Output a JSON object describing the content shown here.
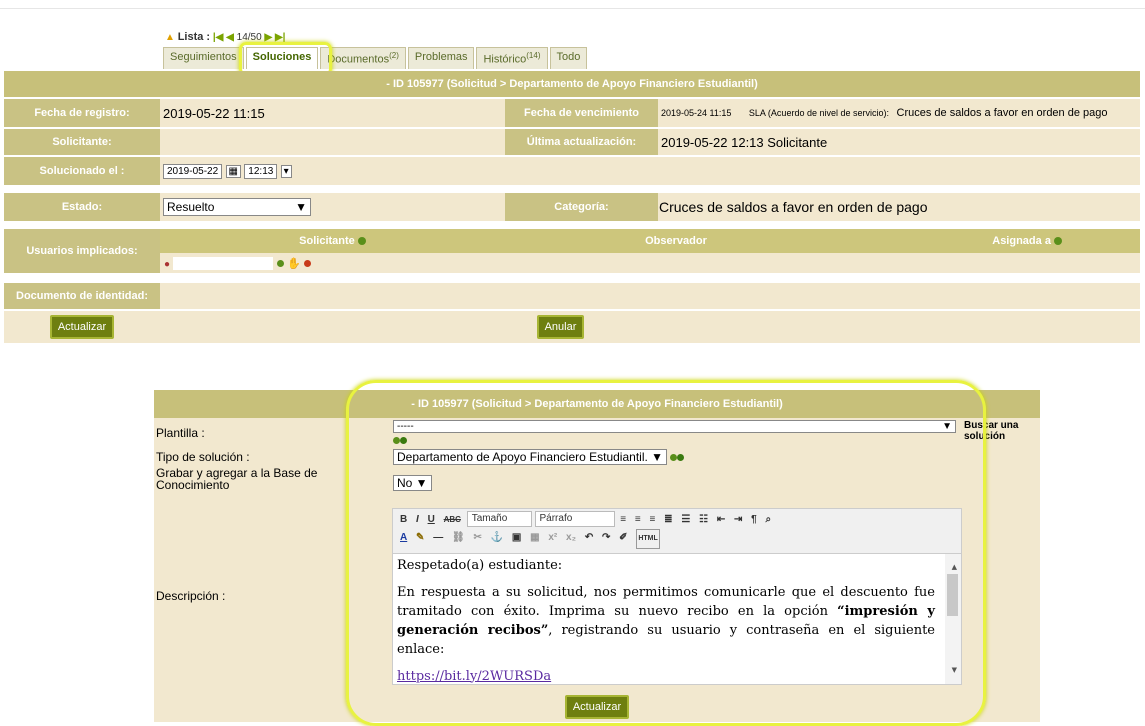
{
  "nav": {
    "lista_label": "Lista :",
    "counter": "14/50"
  },
  "tabs": [
    {
      "label": "Seguimientos",
      "count": ""
    },
    {
      "label": "Soluciones",
      "count": ""
    },
    {
      "label": "Documentos",
      "count": "(2)"
    },
    {
      "label": "Problemas",
      "count": ""
    },
    {
      "label": "Histórico",
      "count": "(14)"
    },
    {
      "label": "Todo",
      "count": ""
    }
  ],
  "ticket": {
    "title": "- ID 105977 (Solicitud > Departamento de Apoyo Financiero Estudiantil)",
    "fecha_registro_label": "Fecha de registro:",
    "fecha_registro": "2019-05-22 11:15",
    "fecha_venc_label": "Fecha de vencimiento",
    "fecha_venc": "2019-05-24 11:15",
    "sla_label": "SLA (Acuerdo de nivel de servicio):",
    "sla_value": "Cruces de saldos a favor en orden de pago",
    "solicitante_label": "Solicitante:",
    "ultima_label": "Última actualización:",
    "ultima_value": "2019-05-22 12:13 Solicitante",
    "solucionado_label": "Solucionado el :",
    "solucionado_date": "2019-05-22",
    "solucionado_time": "12:13",
    "estado_label": "Estado:",
    "estado_value": "Resuelto",
    "categoria_label": "Categoría:",
    "categoria_value": "Cruces de saldos a favor en orden de pago",
    "usuarios_label": "Usuarios implicados:",
    "col_solicitante": "Solicitante",
    "col_observador": "Observador",
    "col_asignada": "Asignada a",
    "documento_label": "Documento de identidad:",
    "actualizar_label": "Actualizar",
    "anular_label": "Anular"
  },
  "solution": {
    "title": "- ID 105977 (Solicitud > Departamento de Apoyo Financiero Estudiantil)",
    "plantilla_label": "Plantilla :",
    "plantilla_value": "-----",
    "buscar_label": "Buscar una solución",
    "tipo_label": "Tipo de solución :",
    "tipo_value": "Departamento de Apoyo Financiero Estudiantil.",
    "grabar_label": "Grabar y agregar a la Base de Conocimiento",
    "grabar_value": "No",
    "descripcion_label": "Descripción :",
    "toolbar": {
      "size": "Tamaño",
      "format": "Párrafo",
      "html": "HTML"
    },
    "content": {
      "greeting": "Respetado(a) estudiante:",
      "p1_a": "En respuesta a su solicitud, nos permitimos comunicarle que el descuento fue tramitado con éxito. Imprima su nuevo recibo en la opción ",
      "p1_bold": "“impresión y generación recibos”",
      "p1_b": ", registrando su usuario y contraseña en el siguiente enlace:",
      "link": "https://bit.ly/2WURSDa"
    },
    "actualizar_label": "Actualizar"
  }
}
